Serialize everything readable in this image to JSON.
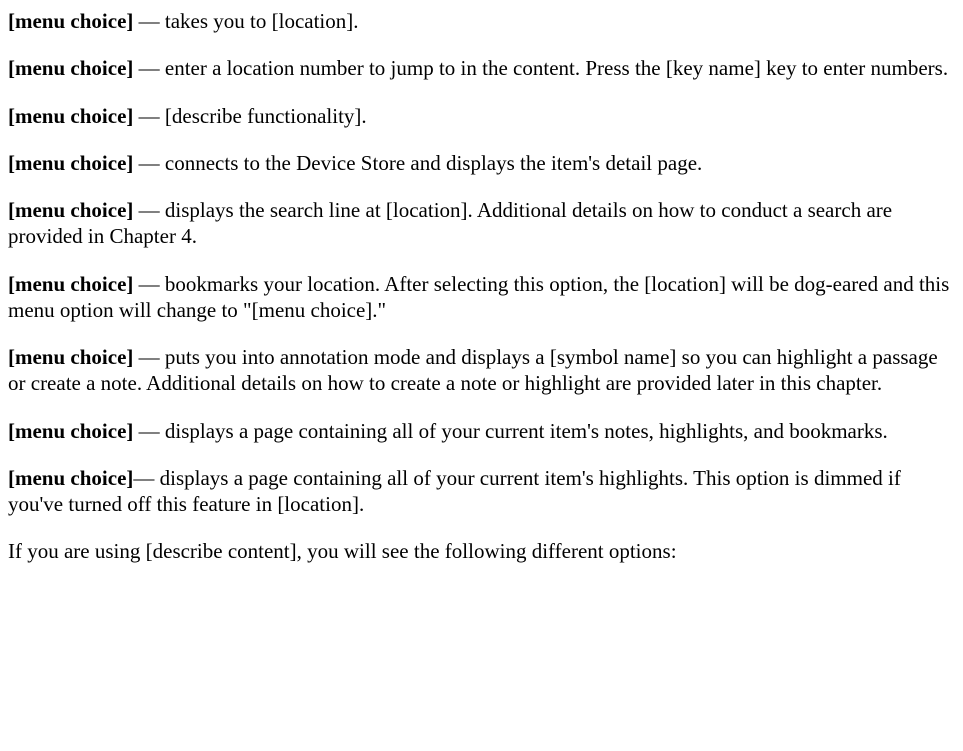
{
  "paragraphs": [
    {
      "bold": "[menu choice]",
      "rest": " — takes you to [location]."
    },
    {
      "bold": "[menu choice]",
      "rest": " — enter a location number to jump to in the content. Press the [key name] key to enter numbers."
    },
    {
      "bold": "[menu choice]",
      "rest": " — [describe functionality]."
    },
    {
      "bold": "[menu choice]",
      "rest": " — connects to the Device Store and displays the item's detail page."
    },
    {
      "bold": "[menu choice]",
      "rest": " — displays the search line at [location]. Additional details on how to conduct a search are provided in Chapter 4."
    },
    {
      "bold": "[menu choice]",
      "rest": " — bookmarks your location. After selecting this option, the [location] will be dog-eared and this menu option will change to \"[menu choice].\""
    },
    {
      "bold": "[menu choice]",
      "rest": " — puts you into annotation mode and displays a [symbol name] so you can highlight a passage or create a note. Additional details on how to create a note or highlight are provided later in this chapter."
    },
    {
      "bold": "[menu choice]",
      "rest": " — displays a page containing all of your current item's notes, highlights, and bookmarks."
    },
    {
      "bold": "[menu choice]",
      "rest": "— displays a page containing all of your current item's highlights. This option is dimmed if you've turned off this feature in [location]."
    },
    {
      "bold": "",
      "rest": "If you are using [describe content], you will see the following different options:"
    }
  ]
}
